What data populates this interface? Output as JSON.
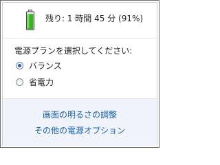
{
  "battery": {
    "status_text": "残り: 1 時間 45 分 (91%)",
    "level": 0.91,
    "color": "#36b51f"
  },
  "prompt": "電源プランを選択してください:",
  "plans": [
    {
      "label": "バランス",
      "selected": true
    },
    {
      "label": "省電力",
      "selected": false
    }
  ],
  "links": {
    "brightness": "画面の明るさの調整",
    "more_options": "その他の電源オプション"
  },
  "colors": {
    "link": "#1a5fa8",
    "footer_bg": "#f0f4fa"
  }
}
